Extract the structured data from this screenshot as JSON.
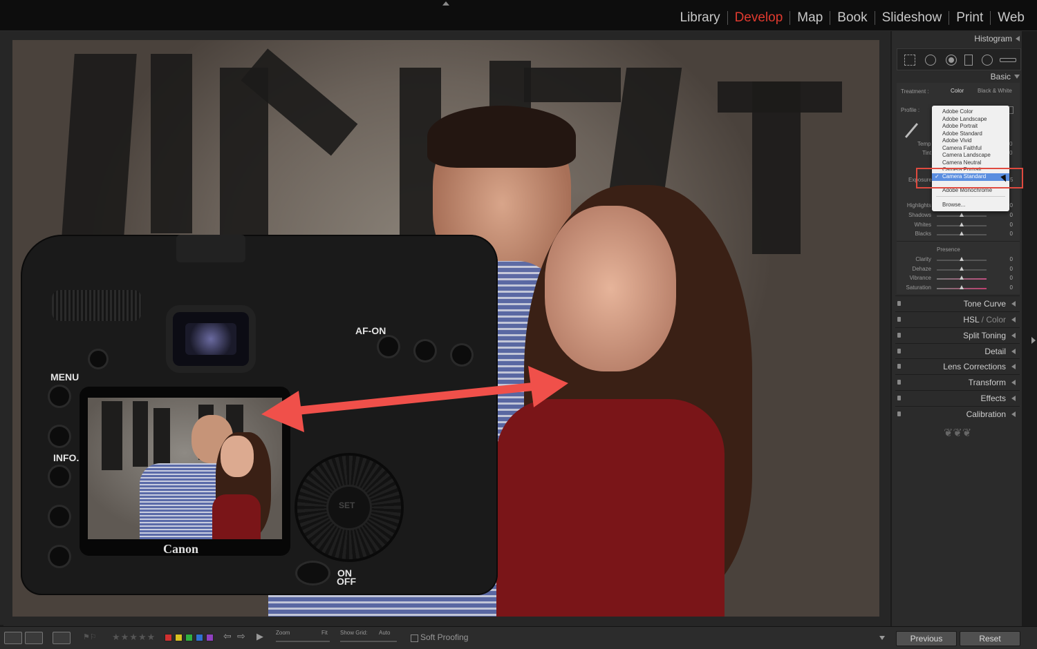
{
  "modules": [
    "Library",
    "Develop",
    "Map",
    "Book",
    "Slideshow",
    "Print",
    "Web"
  ],
  "active_module": "Develop",
  "camera": {
    "menu_label": "MENU",
    "info_label": "INFO.",
    "afon_label": "AF-ON",
    "on_label": "ON",
    "off_label": "OFF",
    "brand": "Canon",
    "set_label": "SET"
  },
  "panel": {
    "histogram": "Histogram",
    "basic": "Basic",
    "treatment_label": "Treatment :",
    "treatment_color": "Color",
    "treatment_bw": "Black & White",
    "profile_label": "Profile :",
    "temp_label": "Temp",
    "tint_label": "Tint",
    "exposure_label": "Exposure",
    "presence_label": "Presence",
    "sliders_tone": [
      {
        "name": "Highlights",
        "value": "0"
      },
      {
        "name": "Shadows",
        "value": "0"
      },
      {
        "name": "Whites",
        "value": "0"
      },
      {
        "name": "Blacks",
        "value": "0"
      }
    ],
    "sliders_presence": [
      {
        "name": "Clarity",
        "value": "0"
      },
      {
        "name": "Dehaze",
        "value": "0"
      },
      {
        "name": "Vibrance",
        "value": "0"
      },
      {
        "name": "Saturation",
        "value": "0"
      }
    ],
    "temp_value": "0",
    "tint_value": "0",
    "exposure_value": "5",
    "sections": [
      "Tone Curve",
      "HSL",
      "Color",
      "Split Toning",
      "Detail",
      "Lens Corrections",
      "Transform",
      "Effects",
      "Calibration"
    ]
  },
  "profile_menu": {
    "items": [
      "Adobe Color",
      "Adobe Landscape",
      "Adobe Portrait",
      "Adobe Standard",
      "Adobe Vivid",
      "Camera Faithful",
      "Camera Landscape",
      "Camera Neutral",
      "Camera Portrait",
      "Camera Standard",
      "Adobe Monochrome",
      "Browse..."
    ],
    "selected": "Camera Standard"
  },
  "bottom": {
    "zoom_label": "Zoom",
    "fit_label": "Fit",
    "grid_label": "Show Grid:",
    "grid_value": "Auto",
    "soft_proofing": "Soft Proofing",
    "previous": "Previous",
    "reset": "Reset",
    "stars": "★★★★★",
    "rating": 0
  },
  "colors": {
    "accent": "#e03a2f",
    "annotation": "#f0504a",
    "panel_bg": "#2b2b2b",
    "selection": "#5a8ee0",
    "labels": [
      "#d03030",
      "#d8c020",
      "#30b040",
      "#3070d0",
      "#9040c0"
    ]
  }
}
